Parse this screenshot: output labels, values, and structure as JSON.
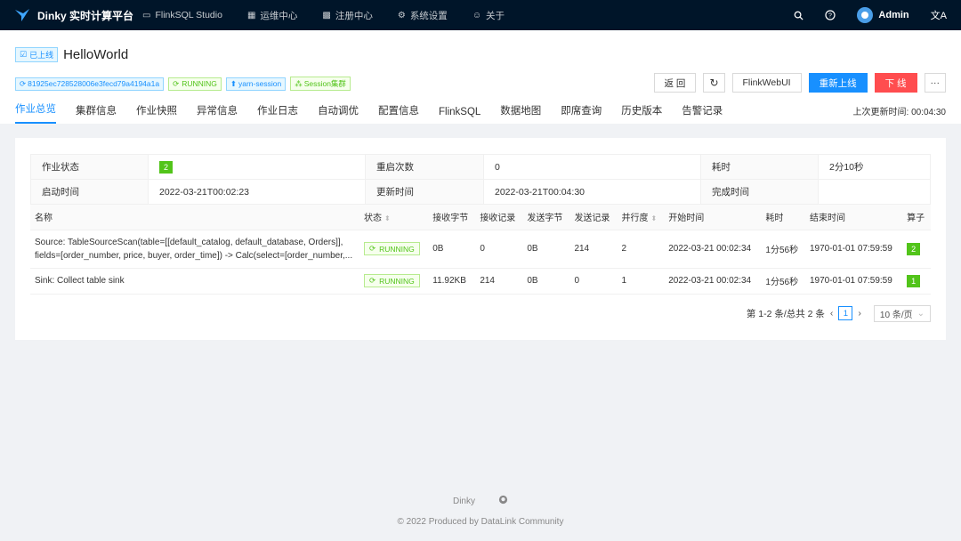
{
  "app": {
    "title": "Dinky 实时计算平台"
  },
  "nav": {
    "items": [
      {
        "label": "FlinkSQL Studio",
        "icon": "laptop-icon"
      },
      {
        "label": "运维中心",
        "icon": "dashboard-icon"
      },
      {
        "label": "注册中心",
        "icon": "appstore-icon"
      },
      {
        "label": "系统设置",
        "icon": "setting-icon"
      },
      {
        "label": "关于",
        "icon": "smile-icon"
      }
    ],
    "user": "Admin"
  },
  "job": {
    "status_tag": "已上线",
    "name": "HelloWorld",
    "tags": {
      "job_id": "81925ec728528006e3fecd79a4194a1a",
      "state": "RUNNING",
      "mode": "yarn-session",
      "cluster": "Session集群"
    }
  },
  "actions": {
    "back": "返 回",
    "webui": "FlinkWebUI",
    "relaunch": "重新上线",
    "offline": "下 线",
    "more": "···"
  },
  "tabs": [
    "作业总览",
    "集群信息",
    "作业快照",
    "异常信息",
    "作业日志",
    "自动调优",
    "配置信息",
    "FlinkSQL",
    "数据地图",
    "即席查询",
    "历史版本",
    "告警记录"
  ],
  "active_tab": 0,
  "last_update": {
    "label": "上次更新时间:",
    "value": "00:04:30"
  },
  "overview": {
    "state_label": "作业状态",
    "state_value": "2",
    "restart_label": "重启次数",
    "restart_value": "0",
    "duration_label": "耗时",
    "duration_value": "2分10秒",
    "start_label": "启动时间",
    "start_value": "2022-03-21T00:02:23",
    "update_label": "更新时间",
    "update_value": "2022-03-21T00:04:30",
    "finish_label": "完成时间",
    "finish_value": ""
  },
  "vertices": {
    "columns": [
      "名称",
      "状态",
      "接收字节",
      "接收记录",
      "发送字节",
      "发送记录",
      "并行度",
      "开始时间",
      "耗时",
      "结束时间",
      "算子"
    ],
    "rows": [
      {
        "name": "Source: TableSourceScan(table=[[default_catalog, default_database, Orders]], fields=[order_number, price, buyer, order_time]) -> Calc(select=[order_number,...",
        "status": "RUNNING",
        "recv_bytes": "0B",
        "recv_records": "0",
        "send_bytes": "0B",
        "send_records": "214",
        "parallelism": "2",
        "start": "2022-03-21 00:02:34",
        "duration": "1分56秒",
        "end": "1970-01-01 07:59:59",
        "ops": "2"
      },
      {
        "name": "Sink: Collect table sink",
        "status": "RUNNING",
        "recv_bytes": "11.92KB",
        "recv_records": "214",
        "send_bytes": "0B",
        "send_records": "0",
        "parallelism": "1",
        "start": "2022-03-21 00:02:34",
        "duration": "1分56秒",
        "end": "1970-01-01 07:59:59",
        "ops": "1"
      }
    ]
  },
  "pagination": {
    "summary": "第 1-2 条/总共 2 条",
    "current": "1",
    "page_size": "10 条/页"
  },
  "footer": {
    "brand": "Dinky",
    "copyright": "© 2022 Produced by DataLink Community"
  }
}
